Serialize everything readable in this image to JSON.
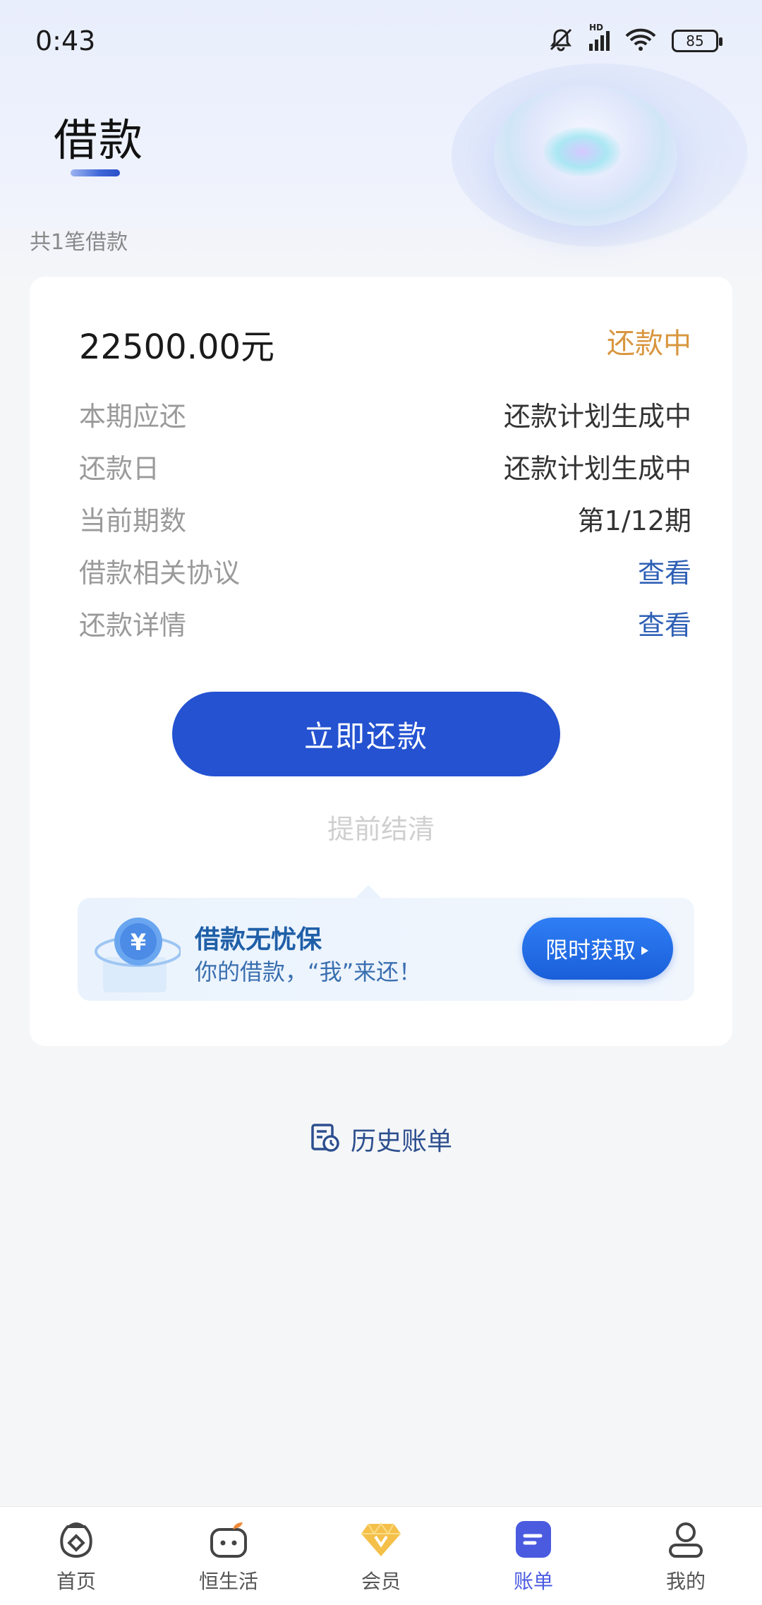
{
  "status_bar": {
    "time": "0:43",
    "battery": "85",
    "network": "HD"
  },
  "page": {
    "title": "借款",
    "loan_count": "共1笔借款"
  },
  "loan_card": {
    "amount": "22500.00元",
    "status": "还款中",
    "rows": [
      {
        "label": "本期应还",
        "value": "还款计划生成中"
      },
      {
        "label": "还款日",
        "value": "还款计划生成中"
      },
      {
        "label": "当前期数",
        "value": "第1/12期"
      },
      {
        "label": "借款相关协议",
        "value": "查看"
      },
      {
        "label": "还款详情",
        "value": "查看"
      }
    ],
    "repay_button": "立即还款",
    "early_settle": "提前结清"
  },
  "promo": {
    "title": "借款无忧保",
    "subtitle": "你的借款，“我”来还！",
    "button": "限时获取"
  },
  "history": {
    "label": "历史账单"
  },
  "bottom_nav": {
    "items": [
      {
        "label": "首页",
        "icon": "home-icon"
      },
      {
        "label": "恒生活",
        "icon": "life-icon"
      },
      {
        "label": "会员",
        "icon": "member-diamond-icon"
      },
      {
        "label": "账单",
        "icon": "bill-icon"
      },
      {
        "label": "我的",
        "icon": "profile-icon"
      }
    ],
    "active": "账单"
  },
  "colors": {
    "primary": "#2452d1",
    "status_orange": "#d9963f",
    "link_blue": "#2d5fb5",
    "nav_active": "#4a5be0"
  }
}
